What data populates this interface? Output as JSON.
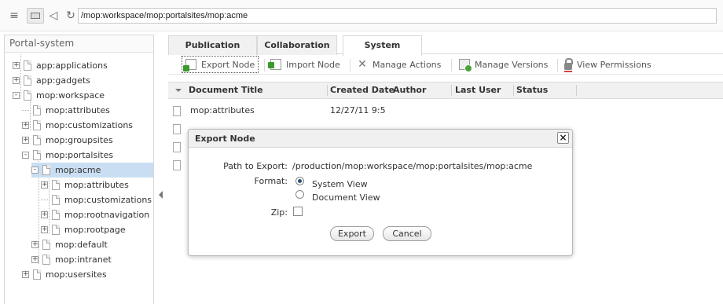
{
  "address_bar": {
    "value": "/mop:workspace/mop:portalsites/mop:acme"
  },
  "left_panel": {
    "title": "Portal-system",
    "tree": [
      {
        "label": "app:applications",
        "expander": "+"
      },
      {
        "label": "app:gadgets",
        "expander": "+"
      },
      {
        "label": "mop:workspace",
        "expander": "-"
      },
      {
        "label": "mop:attributes",
        "expander": ""
      },
      {
        "label": "mop:customizations",
        "expander": "+"
      },
      {
        "label": "mop:groupsites",
        "expander": "+"
      },
      {
        "label": "mop:portalsites",
        "expander": "-"
      },
      {
        "label": "mop:acme",
        "expander": "-",
        "selected": true
      },
      {
        "label": "mop:attributes",
        "expander": "+"
      },
      {
        "label": "mop:customizations",
        "expander": ""
      },
      {
        "label": "mop:rootnavigation",
        "expander": "+"
      },
      {
        "label": "mop:rootpage",
        "expander": "+"
      },
      {
        "label": "mop:default",
        "expander": "+"
      },
      {
        "label": "mop:intranet",
        "expander": "+"
      },
      {
        "label": "mop:usersites",
        "expander": "+"
      }
    ]
  },
  "tabs": [
    {
      "label": "Publication"
    },
    {
      "label": "Collaboration"
    },
    {
      "label": "System",
      "active": true
    }
  ],
  "actions": [
    {
      "label": "Export Node",
      "icon": "export-node-icon"
    },
    {
      "label": "Import Node",
      "icon": "import-node-icon"
    },
    {
      "label": "Manage Actions",
      "icon": "tools-icon"
    },
    {
      "label": "Manage Versions",
      "icon": "versions-icon"
    },
    {
      "label": "View Permissions",
      "icon": "lock-icon"
    }
  ],
  "table": {
    "columns": [
      "Document Title",
      "Created Date",
      "Author",
      "Last User",
      "Status"
    ],
    "rows": [
      {
        "title": "mop:attributes",
        "created": "12/27/11 9:5",
        "author": "",
        "last_user": "",
        "status": ""
      },
      {
        "title": "",
        "created": "",
        "author": "",
        "last_user": "",
        "status": ""
      },
      {
        "title": "",
        "created": "",
        "author": "",
        "last_user": "",
        "status": ""
      },
      {
        "title": "",
        "created": "",
        "author": "",
        "last_user": "",
        "status": ""
      }
    ]
  },
  "dialog": {
    "title": "Export Node",
    "close_label": "×",
    "path_label": "Path to Export:",
    "path_value": "/production/mop:workspace/mop:portalsites/mop:acme",
    "format_label": "Format:",
    "format_options": [
      "System View",
      "Document View"
    ],
    "format_selected": "System View",
    "zip_label": "Zip:",
    "zip_checked": false,
    "export_button": "Export",
    "cancel_button": "Cancel"
  },
  "colors": {
    "selected_row": "#c9def2",
    "icon_green": "#3a9a2a",
    "border": "#d8d8d8"
  }
}
